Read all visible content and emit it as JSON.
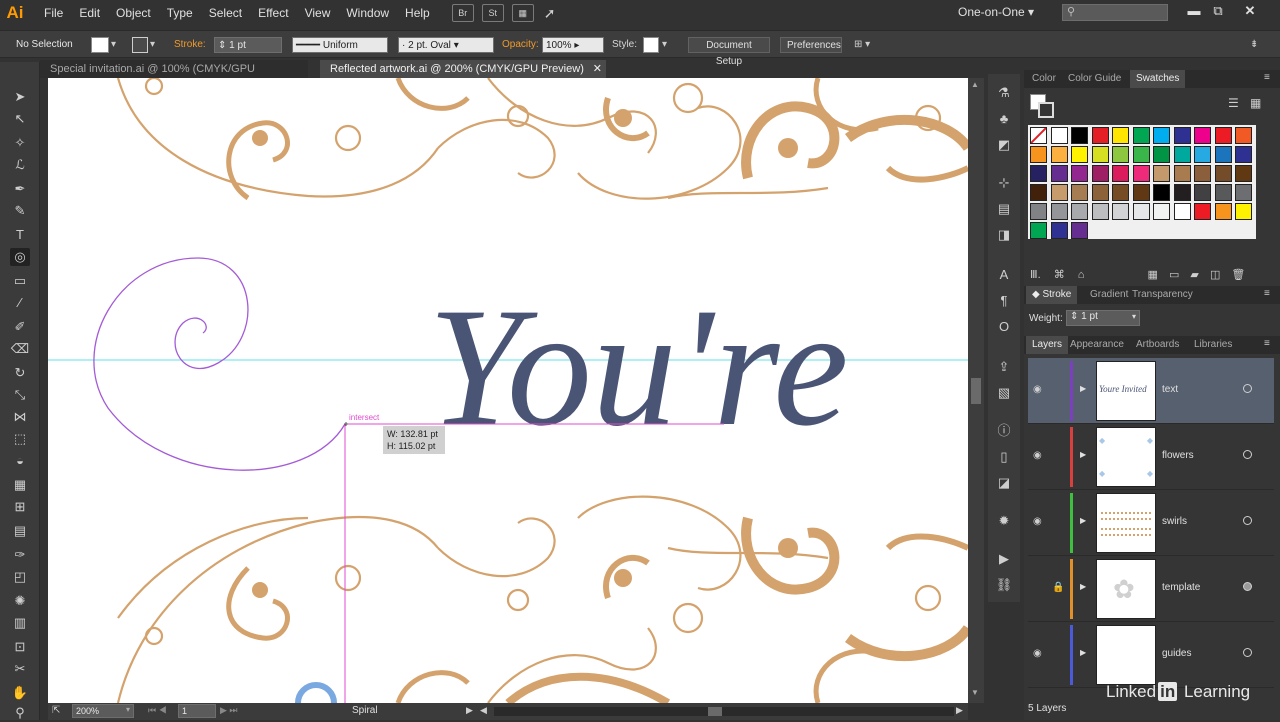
{
  "app": {
    "logo": "Ai"
  },
  "menu": [
    "File",
    "Edit",
    "Object",
    "Type",
    "Select",
    "Effect",
    "View",
    "Window",
    "Help"
  ],
  "menu_icons": {
    "bridge": "Br",
    "stock": "St"
  },
  "workspace": "One-on-One",
  "control": {
    "selection": "No Selection",
    "stroke_label": "Stroke:",
    "stroke_value": "1 pt",
    "profile": "Uniform",
    "brush": "2 pt. Oval",
    "opacity_label": "Opacity:",
    "opacity_value": "100%",
    "style_label": "Style:",
    "doc_setup": "Document Setup",
    "preferences": "Preferences"
  },
  "tabs": [
    {
      "label": "Special invitation.ai @ 100% (CMYK/GPU Preview)",
      "active": false
    },
    {
      "label": "Reflected artwork.ai @ 200% (CMYK/GPU Preview)",
      "active": true
    }
  ],
  "canvas": {
    "smart_guide": "intersect",
    "measure_w": "W: 132.81 pt",
    "measure_h": "H: 115.02 pt",
    "script_text": "You're",
    "colors": {
      "swirl": "#d4a26c",
      "text": "#4a5575",
      "spiral": "#a45bd6",
      "guide": "#5fe0e8",
      "smart": "#e04bd0"
    }
  },
  "status": {
    "zoom": "200%",
    "artboard": "1",
    "tool": "Spiral"
  },
  "panels": {
    "top_tabs": [
      "Color",
      "Color Guide",
      "Swatches"
    ],
    "mid_tabs": [
      "Stroke",
      "Gradient",
      "Transparency"
    ],
    "weight_label": "Weight:",
    "weight_value": "1 pt",
    "layer_tabs": [
      "Layers",
      "Appearance",
      "Artboards",
      "Libraries"
    ]
  },
  "layers": [
    {
      "name": "text",
      "color": "#7b3fbf",
      "thumb": "Youre Invited",
      "selected": true,
      "locked": false,
      "target_filled": false
    },
    {
      "name": "flowers",
      "color": "#d84040",
      "thumb": "",
      "selected": false,
      "locked": false,
      "target_filled": false
    },
    {
      "name": "swirls",
      "color": "#3fbf3f",
      "thumb": "",
      "selected": false,
      "locked": false,
      "target_filled": false
    },
    {
      "name": "template",
      "color": "#e0902a",
      "thumb": "",
      "selected": false,
      "locked": true,
      "target_filled": true
    },
    {
      "name": "guides",
      "color": "#4a5ad8",
      "thumb": "",
      "selected": false,
      "locked": false,
      "target_filled": false
    }
  ],
  "layers_count": "5 Layers",
  "watermark": {
    "brand_a": "Linked",
    "brand_b": "in",
    "brand_c": " Learning"
  },
  "swatches": [
    "#ffffff",
    "#ffffff",
    "#000000",
    "#e31e24",
    "#ffe500",
    "#00a651",
    "#00aeef",
    "#2e3192",
    "#ec008c",
    "#ed1c24",
    "#f15a24",
    "#f7941d",
    "#fbb040",
    "#fff200",
    "#d7df23",
    "#8dc63f",
    "#39b54a",
    "#009444",
    "#00a99d",
    "#27aae1",
    "#1c75bc",
    "#2e3192",
    "#262262",
    "#662d91",
    "#92278f",
    "#9e1f63",
    "#da1c5c",
    "#ee2a7b",
    "#c49a6c",
    "#a97c50",
    "#8b5e3c",
    "#754c29",
    "#603913",
    "#42210b",
    "#c69c6d",
    "#a67c52",
    "#8c6239",
    "#754c24",
    "#603813",
    "#000000",
    "#231f20",
    "#414042",
    "#58595b",
    "#6d6e71",
    "#808285",
    "#939598",
    "#a7a9ac",
    "#bcbec0",
    "#d1d3d4",
    "#e6e7e8",
    "#f1f2f2",
    "#ffffff",
    "#ed1c24",
    "#f7941d",
    "#fff200",
    "#00a651",
    "#2e3192",
    "#662d91"
  ]
}
